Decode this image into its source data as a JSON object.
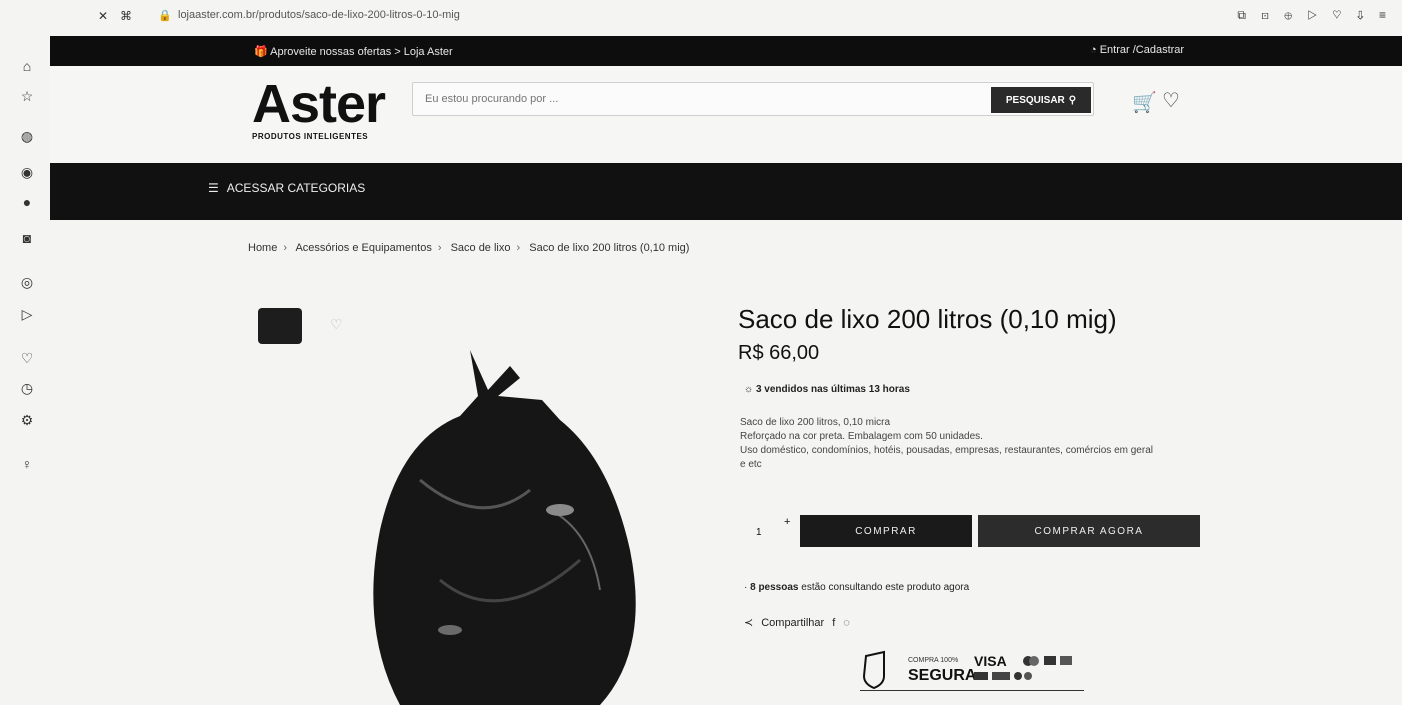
{
  "browser": {
    "url": "lojaaster.com.br/produtos/saco-de-lixo-200-litros-0-10-mig"
  },
  "topbar": {
    "promo_text": "Aproveite nossas ofertas > Loja Aster",
    "account_text": "Entrar /Cadastrar"
  },
  "header": {
    "logo": "Aster",
    "logo_sub": "PRODUTOS INTELIGENTES",
    "search_placeholder": "Eu estou procurando por ...",
    "search_button": "PESQUISAR"
  },
  "nav": {
    "categories_button": "ACESSAR CATEGORIAS"
  },
  "breadcrumb": [
    "Home",
    "Acessórios e Equipamentos",
    "Saco de lixo",
    "Saco de lixo 200 litros (0,10 mig)"
  ],
  "product": {
    "title": "Saco de lixo 200 litros (0,10 mig)",
    "price": "R$ 66,00",
    "sold_text": "3 vendidos nas últimas 13 horas",
    "description": [
      "Saco de lixo 200 litros, 0,10 micra",
      "Reforçado na cor preta. Embalagem com 50 unidades.",
      "Uso doméstico, condomínios, hotéis, pousadas, empresas, restaurantes, comércios em geral",
      "e etc"
    ],
    "quantity": "1",
    "buy_button": "COMPRAR",
    "buy_now_button": "COMPRAR AGORA",
    "viewing_count": "8 pessoas",
    "viewing_text": "estão consultando este produto agora",
    "share_label": "Compartilhar"
  },
  "seal": {
    "small": "COMPRA 100%",
    "big": "SEGURA",
    "brand": "VISA"
  }
}
